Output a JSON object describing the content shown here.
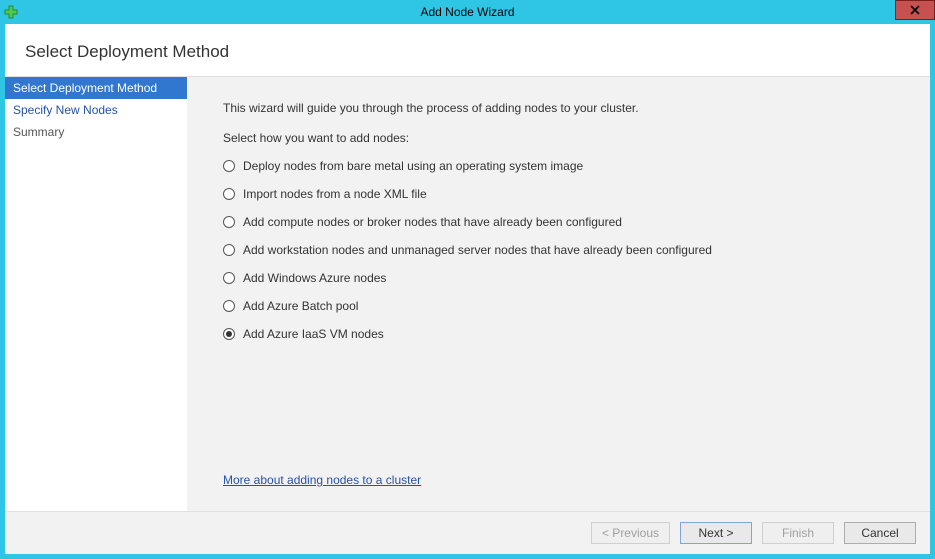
{
  "window": {
    "title": "Add Node Wizard"
  },
  "header": {
    "title": "Select Deployment Method"
  },
  "sidebar": {
    "steps": [
      {
        "label": "Select Deployment Method",
        "state": "active"
      },
      {
        "label": "Specify New Nodes",
        "state": "link"
      },
      {
        "label": "Summary",
        "state": "plain"
      }
    ]
  },
  "content": {
    "intro": "This wizard will guide you through the process of adding nodes to your cluster.",
    "prompt": "Select how you want to add nodes:",
    "options": [
      {
        "label": "Deploy nodes from bare metal using an operating system image",
        "checked": false
      },
      {
        "label": "Import nodes from a node XML file",
        "checked": false
      },
      {
        "label": "Add compute nodes or broker nodes that have already been configured",
        "checked": false
      },
      {
        "label": "Add workstation nodes and unmanaged server nodes that have already been configured",
        "checked": false
      },
      {
        "label": "Add Windows Azure nodes",
        "checked": false
      },
      {
        "label": "Add Azure Batch pool",
        "checked": false
      },
      {
        "label": "Add Azure IaaS VM nodes",
        "checked": true
      }
    ],
    "help_link": "More about adding nodes to a cluster"
  },
  "footer": {
    "previous": "< Previous",
    "next": "Next >",
    "finish": "Finish",
    "cancel": "Cancel"
  }
}
